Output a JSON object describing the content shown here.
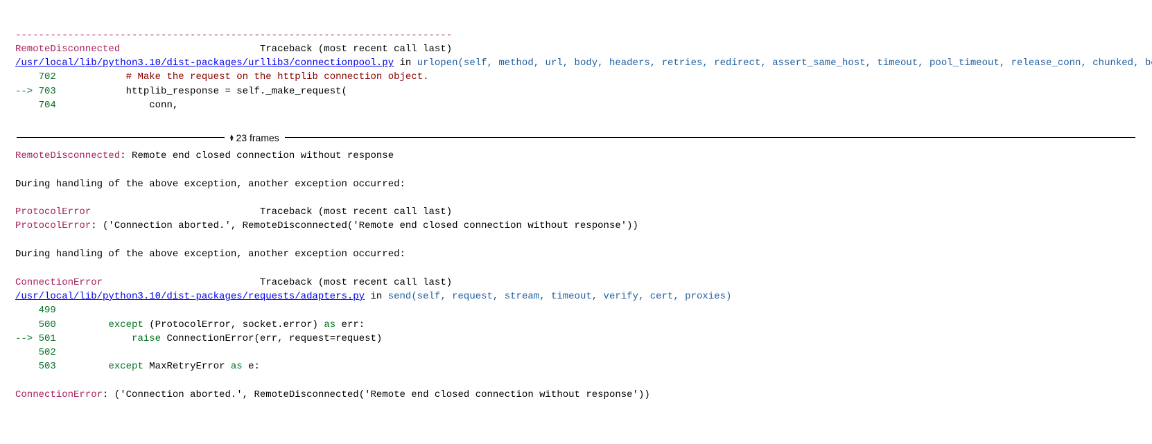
{
  "dashes": "---------------------------------------------------------------------------",
  "tb_label": "Traceback (most recent call last)",
  "exc1": {
    "name": "RemoteDisconnected",
    "file": "/usr/local/lib/python3.10/dist-packages/urllib3/connectionpool.py",
    "in": " in ",
    "func": "urlopen",
    "sig": "(self, method, url, body, headers, retries, redirect, assert_same_host, timeout, pool_timeout, release_conn, chunked, body_pos, **response_kw)",
    "lines": {
      "l702": {
        "no": "702",
        "code": "            # Make the request on the httplib connection object."
      },
      "l703": {
        "prefix": "--> ",
        "no": "703",
        "code": "            httplib_response = self._make_request("
      },
      "l704": {
        "no": "704",
        "code": "                conn,"
      }
    },
    "msg": ": Remote end closed connection without response"
  },
  "frames_label": "23 frames",
  "during": "During handling of the above exception, another exception occurred:",
  "exc2": {
    "name": "ProtocolError",
    "msg": ": ('Connection aborted.', RemoteDisconnected('Remote end closed connection without response'))"
  },
  "exc3": {
    "name": "ConnectionError",
    "file": "/usr/local/lib/python3.10/dist-packages/requests/adapters.py",
    "in": " in ",
    "func": "send",
    "sig": "(self, request, stream, timeout, verify, cert, proxies)",
    "lines": {
      "l499": {
        "no": "499",
        "code": ""
      },
      "l500": {
        "no": "500",
        "kw_except": "except",
        "paren_open": " (ProtocolError, socket.error) ",
        "kw_as": "as",
        "tail": " err:"
      },
      "l501": {
        "prefix": "--> ",
        "no": "501",
        "kw_raise": "raise",
        "tail": " ConnectionError(err, request=request)"
      },
      "l502": {
        "no": "502",
        "code": ""
      },
      "l503": {
        "no": "503",
        "kw_except": "except",
        "mid": " MaxRetryError ",
        "kw_as": "as",
        "tail": " e:"
      }
    },
    "msg": ": ('Connection aborted.', RemoteDisconnected('Remote end closed connection without response'))"
  }
}
